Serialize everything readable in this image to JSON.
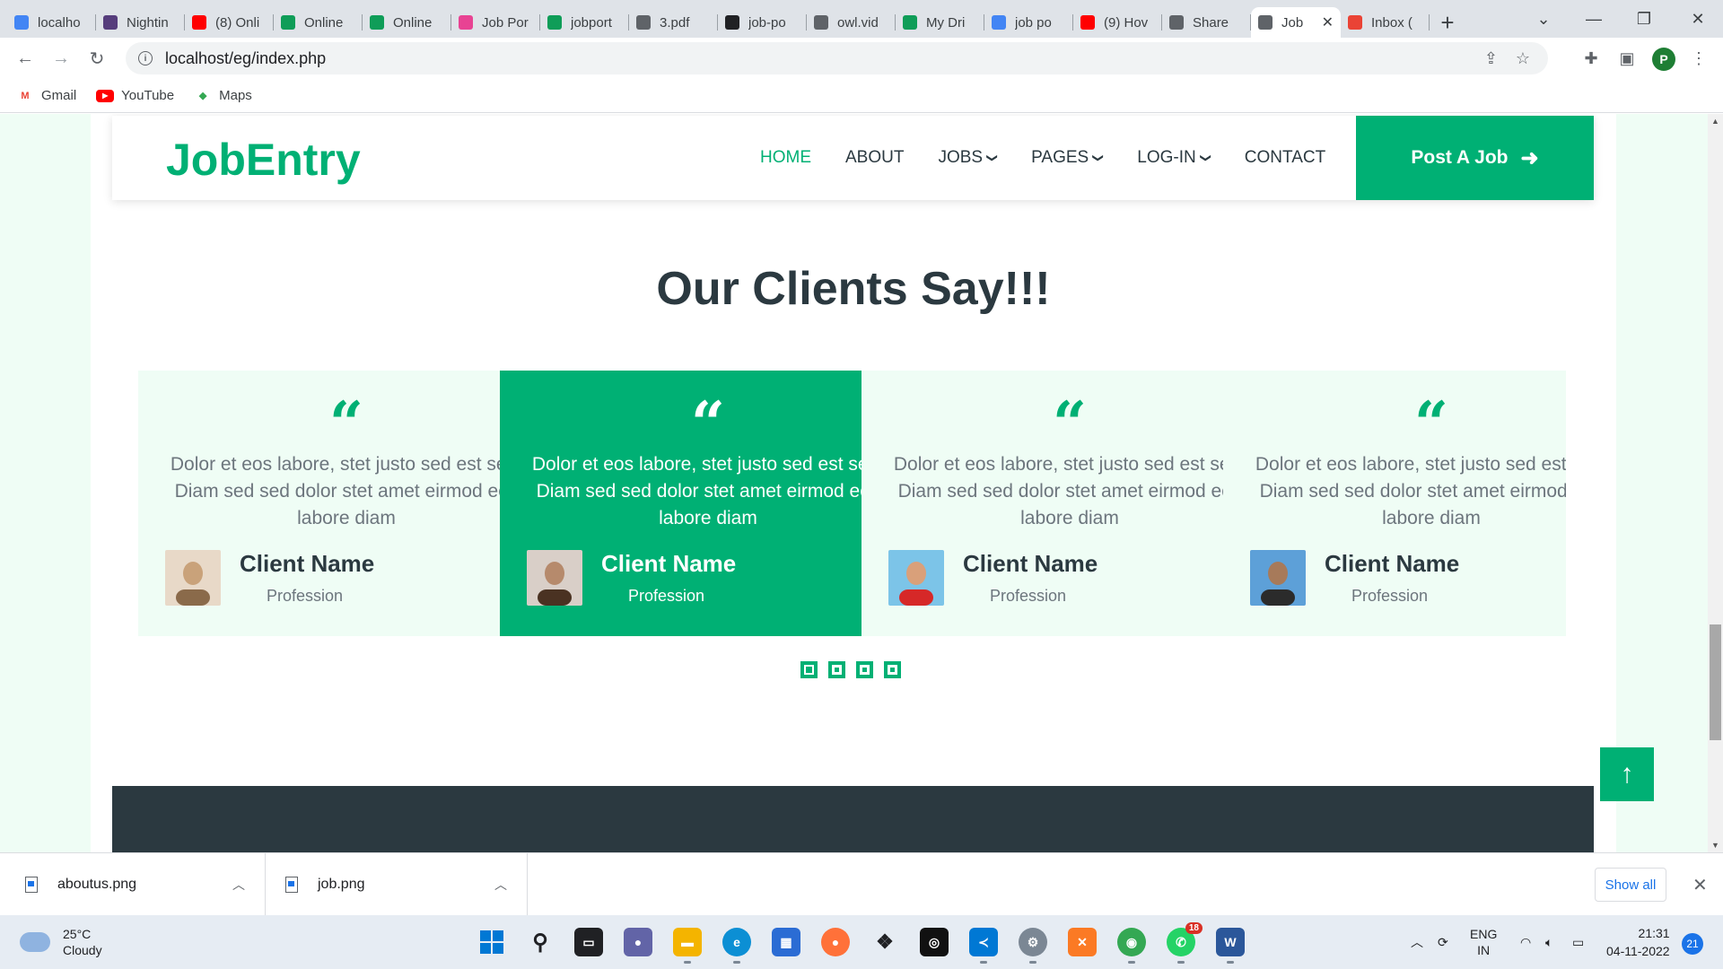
{
  "browser": {
    "tabs": [
      {
        "title": "localho",
        "icon": "google-icon",
        "color": "#4285f4"
      },
      {
        "title": "Nightin",
        "icon": "bootstrap-icon",
        "color": "#563d7c"
      },
      {
        "title": "(8) Onli",
        "icon": "youtube-icon",
        "color": "#ff0000"
      },
      {
        "title": "Online",
        "icon": "drive-icon",
        "color": "#0f9d58"
      },
      {
        "title": "Online",
        "icon": "drive-icon",
        "color": "#0f9d58"
      },
      {
        "title": "Job Por",
        "icon": "cube-icon",
        "color": "#e84393"
      },
      {
        "title": "jobport",
        "icon": "drive-icon",
        "color": "#0f9d58"
      },
      {
        "title": "3.pdf",
        "icon": "globe-icon",
        "color": "#5f6368"
      },
      {
        "title": "job-po",
        "icon": "github-icon",
        "color": "#202124"
      },
      {
        "title": "owl.vid",
        "icon": "globe-icon",
        "color": "#5f6368"
      },
      {
        "title": "My Dri",
        "icon": "drive-icon",
        "color": "#0f9d58"
      },
      {
        "title": "job po",
        "icon": "google-icon",
        "color": "#4285f4"
      },
      {
        "title": "(9) Hov",
        "icon": "youtube-icon",
        "color": "#ff0000"
      },
      {
        "title": "Share",
        "icon": "globe-icon",
        "color": "#5f6368"
      },
      {
        "title": "Job",
        "icon": "globe-icon",
        "color": "#5f6368",
        "active": true
      },
      {
        "title": "Inbox (",
        "icon": "gmail-icon",
        "color": "#ea4335"
      }
    ],
    "url": "localhost/eg/index.php",
    "bookmarks": [
      {
        "label": "Gmail",
        "icon": "gmail-icon"
      },
      {
        "label": "YouTube",
        "icon": "youtube-icon"
      },
      {
        "label": "Maps",
        "icon": "maps-icon"
      }
    ],
    "profile_initial": "P"
  },
  "site": {
    "brand": "JobEntry",
    "accent_color": "#00b074",
    "dark_color": "#2b3940",
    "nav": [
      {
        "label": "HOME",
        "active": true
      },
      {
        "label": "ABOUT"
      },
      {
        "label": "JOBS",
        "dropdown": true
      },
      {
        "label": "PAGES",
        "dropdown": true
      },
      {
        "label": "LOG-IN",
        "dropdown": true
      },
      {
        "label": "CONTACT"
      }
    ],
    "post_job_label": "Post A Job",
    "section_title": "Our Clients Say!!!",
    "testimonials": [
      {
        "text": "Dolor et eos labore, stet justo sed est sed. Diam sed sed dolor stet amet eirmod eos labore diam",
        "name": "Client Name",
        "profession": "Profession"
      },
      {
        "text": "Dolor et eos labore, stet justo sed est sed. Diam sed sed dolor stet amet eirmod eos labore diam",
        "name": "Client Name",
        "profession": "Profession",
        "active": true
      },
      {
        "text": "Dolor et eos labore, stet justo sed est sed. Diam sed sed dolor stet amet eirmod eos labore diam",
        "name": "Client Name",
        "profession": "Profession"
      },
      {
        "text": "Dolor et eos labore, stet justo sed est sed. Diam sed sed dolor stet amet eirmod eos labore diam",
        "name": "Client Name",
        "profession": "Profession"
      }
    ],
    "carousel_dots": 4,
    "carousel_active_dot": 0
  },
  "downloads": {
    "items": [
      "aboutus.png",
      "job.png"
    ],
    "show_all_label": "Show all"
  },
  "taskbar": {
    "weather_temp": "25°C",
    "weather_desc": "Cloudy",
    "whatsapp_badge": "18",
    "lang_1": "ENG",
    "lang_2": "IN",
    "time": "21:31",
    "date": "04-11-2022",
    "notification_count": "21"
  }
}
